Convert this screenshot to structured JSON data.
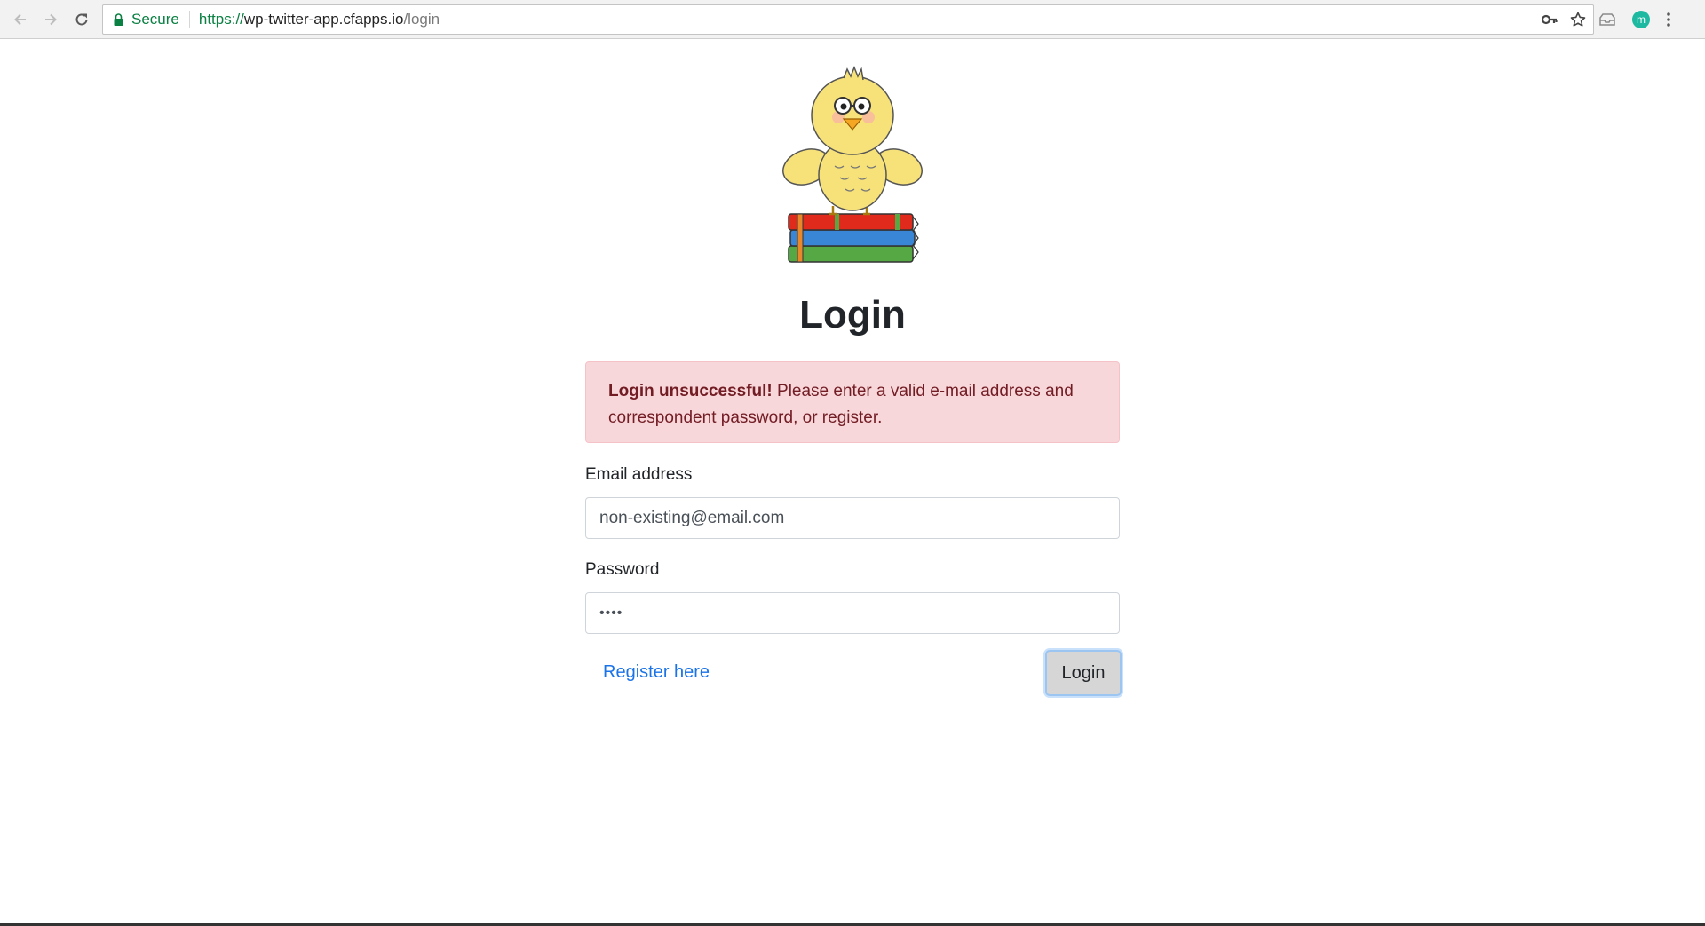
{
  "browser": {
    "secure_label": "Secure",
    "url_scheme": "https://",
    "url_host": "wp-twitter-app.cfapps.io",
    "url_path": "/login",
    "profile_initial": "m",
    "icons": {
      "back": "arrow-left-icon",
      "forward": "arrow-right-icon",
      "reload": "reload-icon",
      "secure": "lock-icon",
      "password_key": "key-icon",
      "bookmark": "star-icon",
      "extension": "inbox-tray-icon",
      "menu": "vertical-dots-icon"
    },
    "colors": {
      "secure_green": "#0b8043",
      "avatar": "#1db9a0"
    }
  },
  "page": {
    "logo": "yellow-chick-on-books",
    "title": "Login",
    "alert": {
      "strong": "Login unsuccessful!",
      "message": " Please enter a valid e-mail address and correspondent password, or register."
    },
    "email": {
      "label": "Email address",
      "value": "non-existing@email.com"
    },
    "password": {
      "label": "Password",
      "value": "••••"
    },
    "register_link": "Register here",
    "login_button": "Login"
  },
  "colors": {
    "alert_bg": "#f8d7da",
    "alert_text": "#721c24",
    "link": "#1a73e8",
    "title": "#212529"
  }
}
